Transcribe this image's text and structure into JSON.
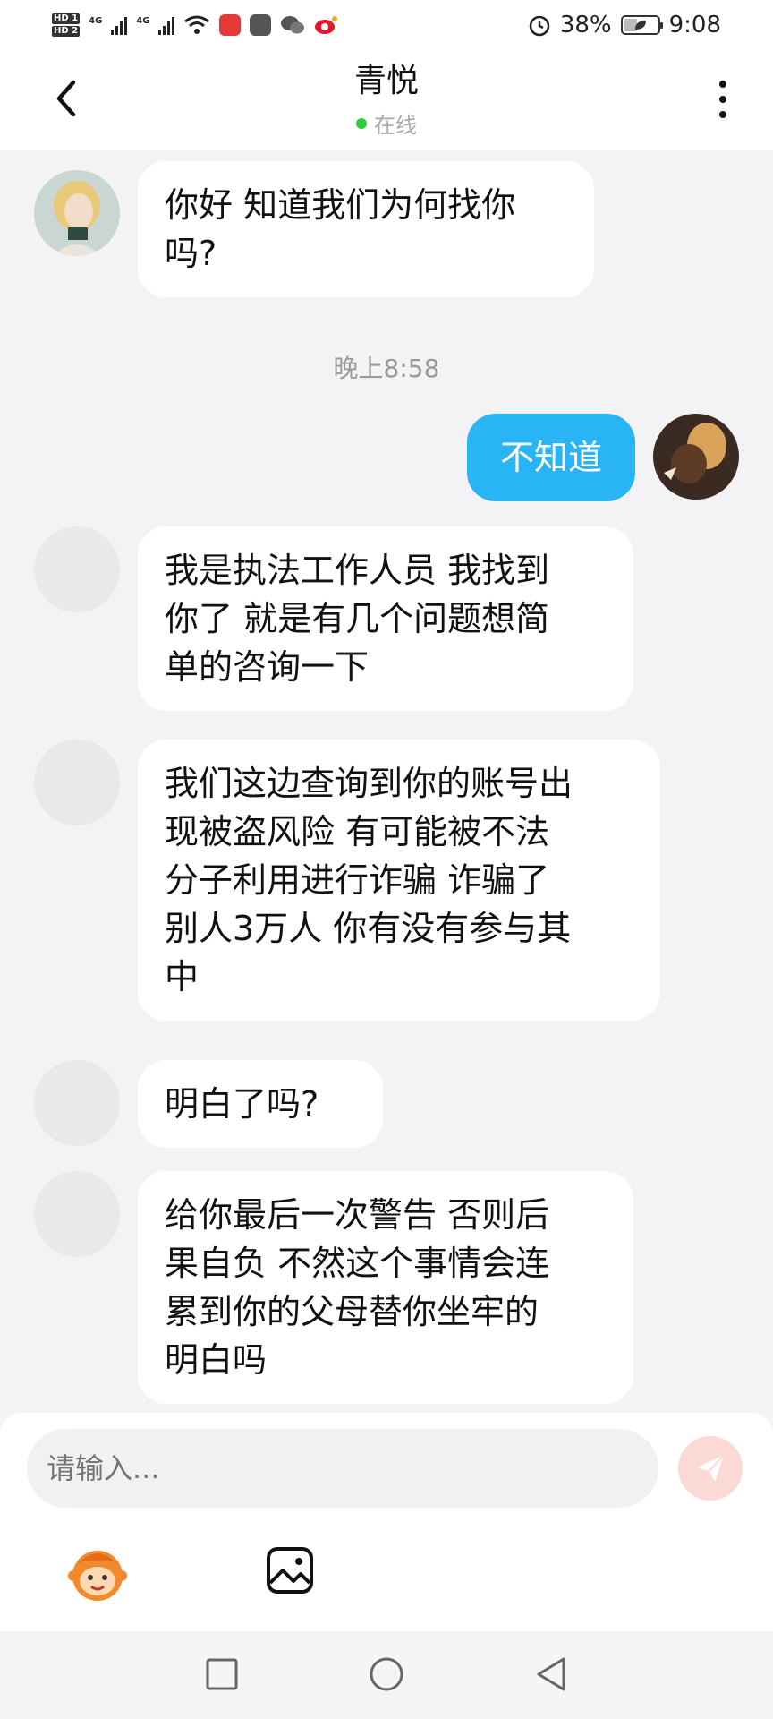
{
  "status_bar": {
    "network": "4G",
    "battery": "38%",
    "battery_level": 0.38,
    "time": "9:08",
    "hd1": "HD 1",
    "hd2": "HD 2"
  },
  "header": {
    "title": "青悦",
    "status": "在线",
    "status_color": "#2ecc40"
  },
  "messages": [
    {
      "side": "in",
      "text": "你好 知道我们为何找你\n吗?",
      "avatar": "illustrated-girl-avatar"
    },
    {
      "type": "timestamp",
      "text": "晚上8:58"
    },
    {
      "side": "out",
      "text": "不知道",
      "avatar": "user-photo-avatar"
    },
    {
      "side": "in",
      "text": "我是执法工作人员 我找到\n你了 就是有几个问题想简\n单的咨询一下"
    },
    {
      "side": "in",
      "text": "我们这边查询到你的账号出\n现被盗风险 有可能被不法\n分子利用进行诈骗 诈骗了\n别人3万人 你有没有参与其\n中"
    },
    {
      "side": "in",
      "text": "明白了吗?"
    },
    {
      "side": "in",
      "text": "给你最后一次警告 否则后\n果自负 不然这个事情会连\n累到你的父母替你坐牢的\n明白吗"
    }
  ],
  "input": {
    "placeholder": "请输入..."
  },
  "colors": {
    "outgoing_bubble": "#28b4f5",
    "incoming_bubble": "#ffffff",
    "send_button": "#f7b3ab"
  },
  "icons": [
    "back-icon",
    "more-icon",
    "send-icon",
    "emoji-icon",
    "image-icon",
    "recent-apps-icon",
    "home-icon",
    "back-nav-icon"
  ]
}
